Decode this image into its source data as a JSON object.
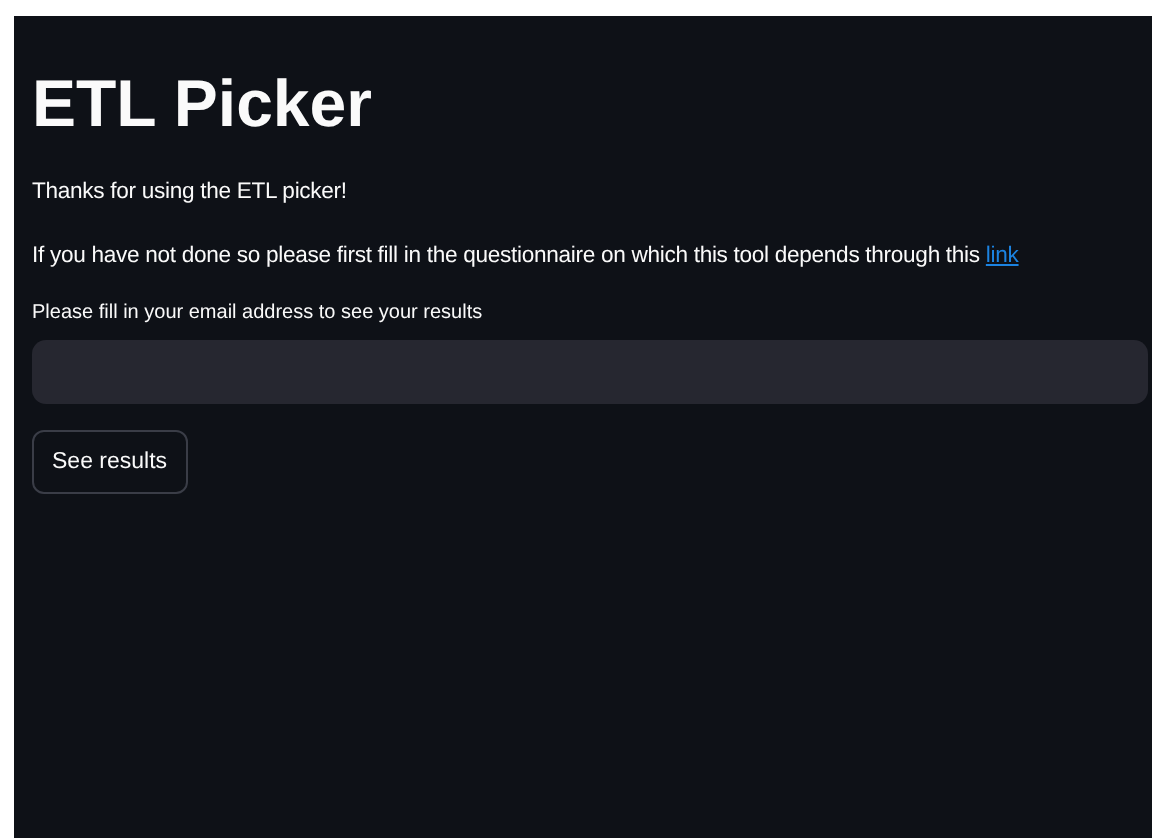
{
  "title": "ETL Picker",
  "paragraphs": [
    "Thanks for using the ETL picker!"
  ],
  "questionnaire_note": {
    "text": "If you have not done so please first fill in the questionnaire on which this tool depends through this",
    "link": "link"
  },
  "email_field": {
    "label": "Please fill in your email address to see your results"
  },
  "button": "See results"
}
